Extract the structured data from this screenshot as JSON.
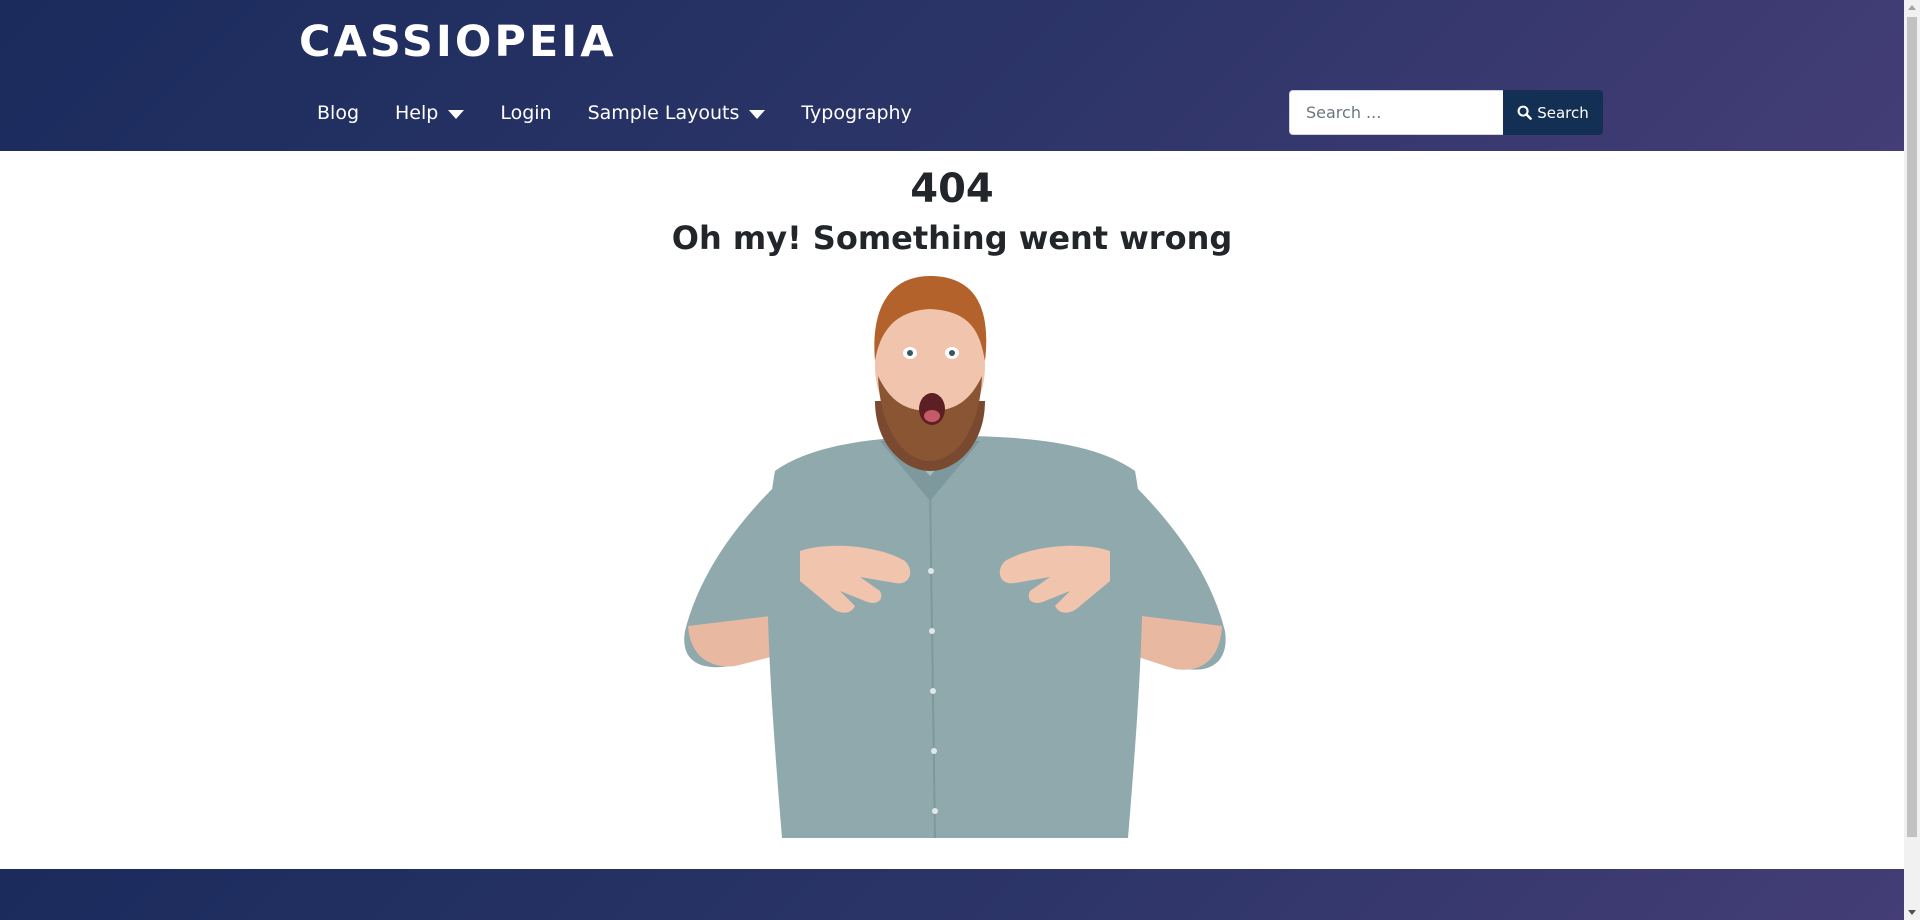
{
  "header": {
    "brand": "CASSIOPEIA",
    "nav": [
      {
        "label": "Blog",
        "has_dropdown": false
      },
      {
        "label": "Help",
        "has_dropdown": true
      },
      {
        "label": "Login",
        "has_dropdown": false
      },
      {
        "label": "Sample Layouts",
        "has_dropdown": true
      },
      {
        "label": "Typography",
        "has_dropdown": false
      }
    ],
    "search": {
      "placeholder": "Search ...",
      "value": "",
      "button_label": "Search",
      "button_icon": "search-icon"
    }
  },
  "main": {
    "error_code": "404",
    "error_title": "Oh my! Something went wrong",
    "image_subject": "surprised-man-image"
  },
  "colors": {
    "header_gradient_start": "#1a2b5c",
    "header_gradient_end": "#443d76",
    "search_button": "#132f53",
    "heading_text": "#22262a",
    "shirt": "#8fa9ad"
  }
}
